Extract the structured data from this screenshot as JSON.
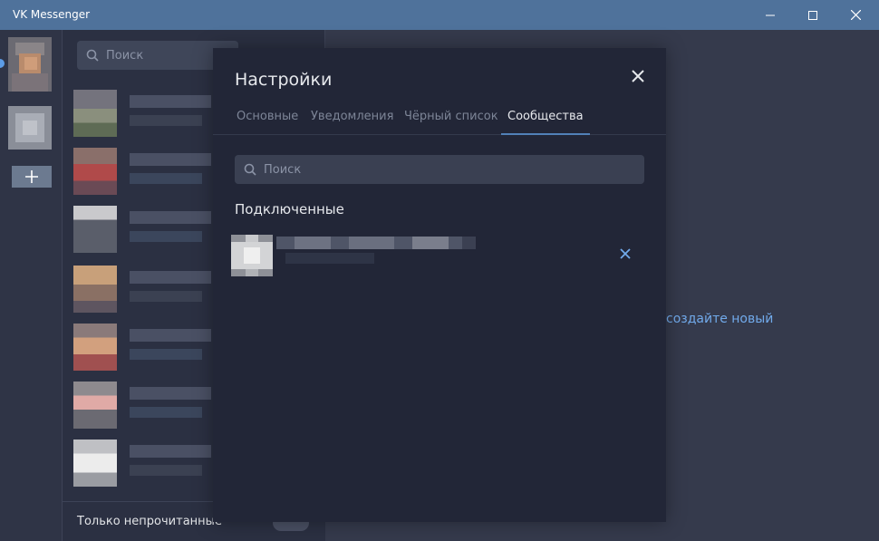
{
  "window": {
    "title": "VK Messenger",
    "controls": [
      "minimize",
      "maximize",
      "close"
    ]
  },
  "sidebar": {
    "search_placeholder": "Поиск",
    "only_unread_label": "Только непрочитанные"
  },
  "main": {
    "hint_text": "создайте новый"
  },
  "settings": {
    "title": "Настройки",
    "tabs": [
      {
        "label": "Основные",
        "active": false
      },
      {
        "label": "Уведомления",
        "active": false
      },
      {
        "label": "Чёрный список",
        "active": false
      },
      {
        "label": "Сообщества",
        "active": true
      }
    ],
    "search_placeholder": "Поиск",
    "section_title": "Подключенные"
  },
  "icons": {
    "search": "search-icon",
    "close": "close-icon",
    "remove": "remove-icon",
    "add": "plus-icon"
  },
  "colors": {
    "titlebar": "#4f729b",
    "accent": "#5181b8",
    "link": "#71aaeb",
    "modal_bg": "#222637"
  }
}
